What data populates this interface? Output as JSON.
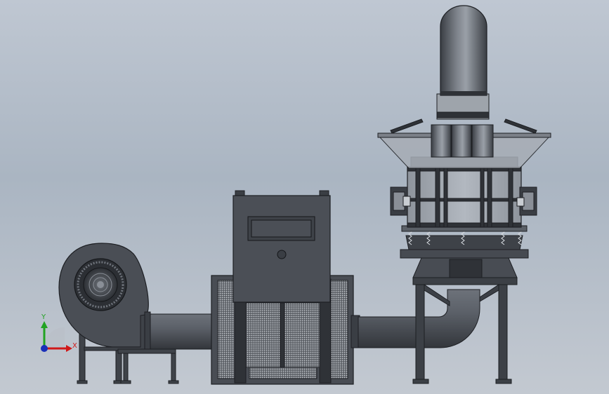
{
  "viewport": {
    "background_top": "#bfc7d2",
    "background_bottom": "#c3c9d1"
  },
  "model": {
    "components": [
      "centrifugal-fan",
      "inlet-duct",
      "filter-housing",
      "control-box",
      "outlet-elbow-duct",
      "tower-reactor",
      "stack-chimney",
      "support-frame"
    ],
    "body_color": "#4a4e55",
    "dark_color": "#2b2e33",
    "highlight_color": "#8b9099"
  },
  "triad": {
    "x_label": "X",
    "y_label": "Y",
    "x_color": "#d01818",
    "y_color": "#22a322",
    "z_color": "#1a2fb8"
  }
}
